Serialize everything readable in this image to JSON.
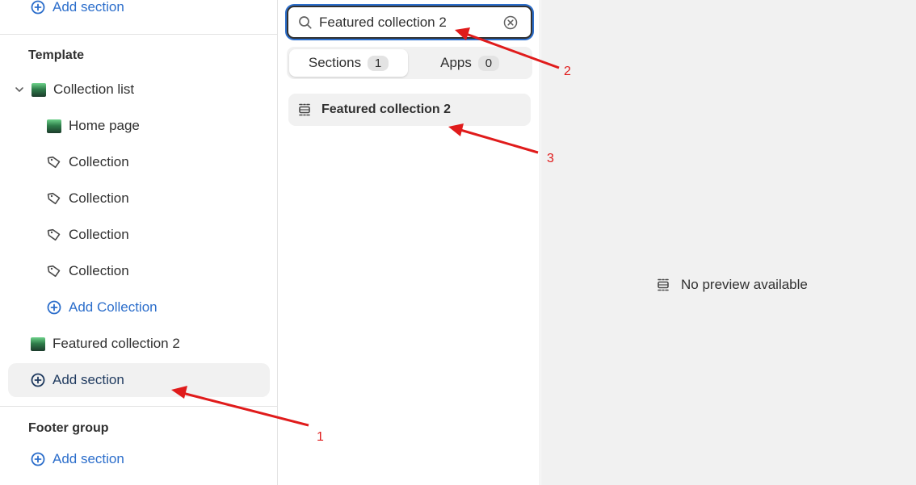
{
  "sidebar": {
    "top_add_section": "Add section",
    "template_heading": "Template",
    "collection_list": "Collection list",
    "children": [
      {
        "label": "Home page",
        "icon": "image-thumbnail-icon"
      },
      {
        "label": "Collection",
        "icon": "tag-icon"
      },
      {
        "label": "Collection",
        "icon": "tag-icon"
      },
      {
        "label": "Collection",
        "icon": "tag-icon"
      },
      {
        "label": "Collection",
        "icon": "tag-icon"
      }
    ],
    "add_collection": "Add Collection",
    "featured_collection": "Featured collection 2",
    "add_section": "Add section",
    "footer_heading": "Footer group",
    "footer_add_section": "Add section"
  },
  "search": {
    "value": "Featured collection 2"
  },
  "tabs": {
    "sections_label": "Sections",
    "sections_count": "1",
    "apps_label": "Apps",
    "apps_count": "0"
  },
  "result": {
    "label": "Featured collection 2"
  },
  "preview": {
    "message": "No preview available"
  },
  "annotations": {
    "one": "1",
    "two": "2",
    "three": "3",
    "color": "#e01b1b"
  },
  "colors": {
    "link_blue": "#2c6ecb",
    "text": "#303030",
    "highlight_bg": "#f1f1f1"
  }
}
